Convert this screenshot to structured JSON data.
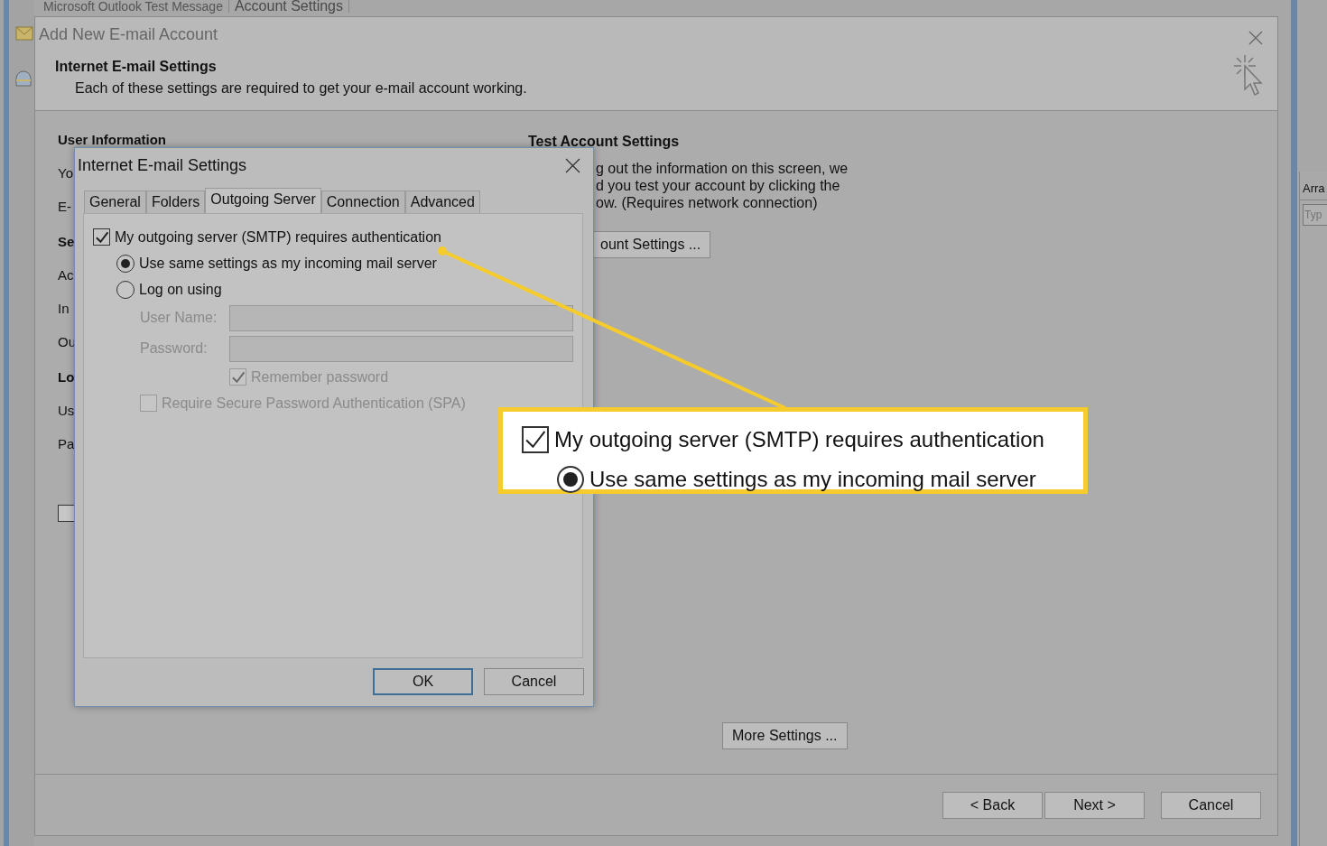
{
  "background_window": {
    "tabs": [
      {
        "label": "Microsoft Outlook Test Message",
        "selected": false
      },
      {
        "label": "Account Settings",
        "selected": true
      }
    ],
    "side_panel": {
      "heading": "Arra",
      "placeholder": "Typ"
    }
  },
  "wizard": {
    "title": "Add New E-mail Account",
    "heading": "Internet E-mail Settings",
    "subheading": "Each of these settings are required to get your e-mail account working.",
    "left_items": [
      {
        "kind": "heading",
        "text": "User Information"
      },
      {
        "kind": "label",
        "text": "Yo"
      },
      {
        "kind": "label",
        "text": "E-"
      },
      {
        "kind": "heading",
        "text": "Se"
      },
      {
        "kind": "label",
        "text": "Ac"
      },
      {
        "kind": "label",
        "text": "In"
      },
      {
        "kind": "label",
        "text": "Ou"
      },
      {
        "kind": "heading",
        "text": "Lo"
      },
      {
        "kind": "label",
        "text": "Us"
      },
      {
        "kind": "label",
        "text": "Pa"
      },
      {
        "kind": "checkbox",
        "checked": false
      }
    ],
    "test_section": {
      "heading": "Test Account Settings",
      "lines": [
        "g out the information on this screen, we",
        "d you test your account by clicking the",
        "ow. (Requires network connection)"
      ],
      "button": "ount Settings ..."
    },
    "more_settings": "More Settings ...",
    "buttons": [
      "< Back",
      "Next >",
      "Cancel"
    ]
  },
  "dialog": {
    "title": "Internet E-mail Settings",
    "tabs": [
      {
        "label": "General",
        "selected": false
      },
      {
        "label": "Folders",
        "selected": false
      },
      {
        "label": "Outgoing Server",
        "selected": true
      },
      {
        "label": "Connection",
        "selected": false
      },
      {
        "label": "Advanced",
        "selected": false
      }
    ],
    "options": [
      {
        "kind": "checkbox",
        "label": "My outgoing server (SMTP) requires authentication",
        "checked": true,
        "disabled": false,
        "children": [
          {
            "kind": "radio",
            "label": "Use same settings as my incoming mail server",
            "selected": true,
            "disabled": false
          },
          {
            "kind": "radio",
            "label": "Log on using",
            "selected": false,
            "disabled": false,
            "children": [
              {
                "kind": "field",
                "label": "User Name:",
                "disabled": true
              },
              {
                "kind": "field",
                "label": "Password:",
                "disabled": true
              },
              {
                "kind": "field-checkbox",
                "label": "Remember password",
                "checked": true,
                "disabled": true
              },
              {
                "kind": "checkbox",
                "label": "Require Secure Password Authentication (SPA)",
                "checked": false,
                "disabled": true
              }
            ]
          }
        ]
      }
    ],
    "buttons": [
      {
        "label": "OK",
        "default": true
      },
      {
        "label": "Cancel",
        "default": false
      }
    ]
  },
  "callout": {
    "items": [
      {
        "kind": "checkbox",
        "label": "My outgoing server (SMTP) requires authentication",
        "checked": true
      },
      {
        "kind": "radio",
        "label": "Use same settings as my incoming mail server",
        "selected": true
      }
    ]
  }
}
